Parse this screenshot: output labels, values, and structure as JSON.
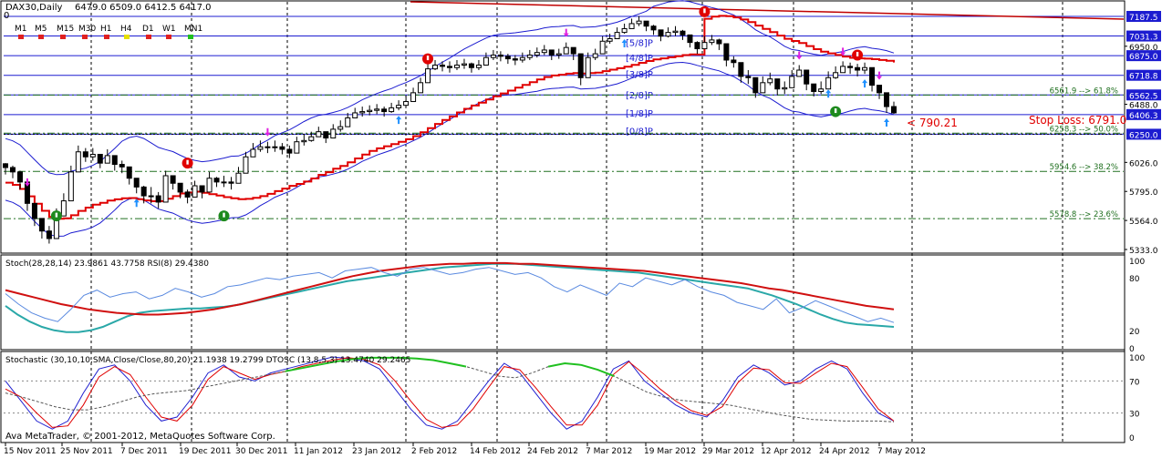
{
  "header": {
    "symbol": "DAX30,Daily",
    "ohlc": "6479.0 6509.0 6412.5 6417.0",
    "indicator_value": "0"
  },
  "timeframes": [
    {
      "label": "M1",
      "color": "#e02020"
    },
    {
      "label": "M5",
      "color": "#e02020"
    },
    {
      "label": "M15",
      "color": "#e02020"
    },
    {
      "label": "M30",
      "color": "#e02020"
    },
    {
      "label": "H1",
      "color": "#e02020"
    },
    {
      "label": "H4",
      "color": "#e6e000"
    },
    {
      "label": "D1",
      "color": "#e02020"
    },
    {
      "label": "W1",
      "color": "#e02020"
    },
    {
      "label": "MN1",
      "color": "#20c020"
    }
  ],
  "colors": {
    "background": "#ffffff",
    "grid": "#000000",
    "murrey": "#1c1cd0",
    "envelope": "#1c1cd0",
    "trail": "#e00000",
    "fib": "#207020",
    "up_arrow": "#1e90ff",
    "down_arrow": "#e020e0",
    "fractal_red": "#e00000",
    "fractal_green": "#1e8a1e",
    "price_box": "#1c1cd0",
    "stoch_main": "#2aa8a8",
    "stoch_signal": "#d01010",
    "rsi": "#5a8ae0",
    "dtosc_blue": "#2020d0",
    "dtosc_red": "#e00000",
    "green": "#20c020",
    "stoploss": "#e00000"
  },
  "price_labels": [
    "7187.5",
    "7031.3",
    "6950.0",
    "6875.0",
    "6718.8",
    "6562.5",
    "6488.0",
    "6406.3",
    "6250.0",
    "6026.0",
    "5795.0",
    "5564.0",
    "5333.0"
  ],
  "price_boxes": [
    "7187.5",
    "7031.3",
    "6875.0",
    "6718.8",
    "6562.5",
    "6406.3",
    "6250.0"
  ],
  "murrey_labels": [
    "[5/8]P",
    "[4/8]P",
    "[3/8]P",
    "[2/8]P",
    "[1/8]P",
    "[0/8]P"
  ],
  "fib_labels": [
    "6561.9 --> 61.8%",
    "6258.3 --> 50.0%",
    "5954.6 --> 38.2%",
    "5578.8 --> 23.6%"
  ],
  "annotations": {
    "stop_loss": "Stop Loss: 6791.0",
    "target": "< 790.21"
  },
  "panel2": {
    "title": "Stoch(28,28,14) 23.9861 43.7758  RSI(8) 29.4380",
    "levels": [
      "100",
      "80",
      "20",
      "0"
    ]
  },
  "panel3": {
    "title": "Stochastic (30,10,10,SMA,Close/Close,80,20) 21.1938 19.2799   DTOSC (13,8,5,3) 13.4740 29.2465",
    "levels": [
      "100",
      "70",
      "30",
      "0"
    ]
  },
  "watermark": "Ava MetaTrader, © 2001-2012, MetaQuotes Software Corp.",
  "x_labels": [
    "15 Nov 2011",
    "25 Nov 2011",
    "7 Dec 2011",
    "19 Dec 2011",
    "30 Dec 2011",
    "11 Jan 2012",
    "23 Jan 2012",
    "2 Feb 2012",
    "14 Feb 2012",
    "24 Feb 2012",
    "7 Mar 2012",
    "19 Mar 2012",
    "29 Mar 2012",
    "12 Apr 2012",
    "24 Apr 2012",
    "7 May 2012"
  ],
  "chart_data": [
    {
      "type": "candlestick",
      "title": "DAX30,Daily",
      "ohlc_last": [
        6479.0,
        6509.0,
        6412.5,
        6417.0
      ],
      "ylim": [
        5333.0,
        7187.5
      ],
      "murrey_levels": [
        7187.5,
        7031.3,
        6875.0,
        6718.8,
        6562.5,
        6406.3,
        6250.0
      ],
      "fib_levels": [
        {
          "value": 6561.9,
          "pct": "61.8%"
        },
        {
          "value": 6258.3,
          "pct": "50.0%"
        },
        {
          "value": 5954.6,
          "pct": "38.2%"
        },
        {
          "value": 5578.8,
          "pct": "23.6%"
        }
      ],
      "closes": [
        5985,
        5950,
        5870,
        5700,
        5580,
        5480,
        5420,
        5600,
        5720,
        5950,
        6110,
        6070,
        6090,
        6020,
        6080,
        6010,
        5990,
        5900,
        5830,
        5760,
        5760,
        5710,
        5920,
        5860,
        5790,
        5750,
        5840,
        5790,
        5900,
        5870,
        5870,
        5860,
        5940,
        6070,
        6130,
        6150,
        6150,
        6150,
        6130,
        6100,
        6190,
        6200,
        6230,
        6270,
        6220,
        6290,
        6310,
        6380,
        6420,
        6430,
        6440,
        6450,
        6430,
        6460,
        6480,
        6510,
        6580,
        6660,
        6770,
        6800,
        6790,
        6780,
        6800,
        6810,
        6780,
        6800,
        6860,
        6880,
        6870,
        6850,
        6840,
        6860,
        6880,
        6900,
        6920,
        6880,
        6890,
        6940,
        6890,
        6700,
        6860,
        6890,
        6990,
        7010,
        7060,
        7090,
        7130,
        7150,
        7110,
        7080,
        7030,
        7060,
        7070,
        7040,
        6980,
        6930,
        6980,
        7000,
        6970,
        6840,
        6820,
        6710,
        6700,
        6580,
        6660,
        6690,
        6610,
        6620,
        6710,
        6760,
        6650,
        6590,
        6610,
        6700,
        6740,
        6790,
        6780,
        6760,
        6780,
        6640,
        6580,
        6470,
        6420
      ],
      "highs": [
        6020,
        6000,
        5960,
        5790,
        5680,
        5560,
        5520,
        5660,
        5780,
        6000,
        6160,
        6140,
        6140,
        6090,
        6130,
        6080,
        6040,
        5980,
        5900,
        5840,
        5830,
        5790,
        5960,
        5910,
        5860,
        5810,
        5880,
        5840,
        5950,
        5910,
        5920,
        5910,
        5990,
        6110,
        6180,
        6200,
        6190,
        6200,
        6180,
        6160,
        6230,
        6250,
        6270,
        6310,
        6270,
        6330,
        6360,
        6420,
        6460,
        6470,
        6480,
        6490,
        6470,
        6500,
        6520,
        6560,
        6620,
        6700,
        6810,
        6840,
        6830,
        6830,
        6840,
        6850,
        6820,
        6840,
        6900,
        6920,
        6910,
        6890,
        6880,
        6900,
        6920,
        6940,
        6960,
        6920,
        6930,
        6980,
        6930,
        6780,
        6900,
        6930,
        7030,
        7050,
        7100,
        7130,
        7170,
        7190,
        7150,
        7120,
        7080,
        7100,
        7110,
        7080,
        7030,
        6990,
        7030,
        7040,
        7010,
        6900,
        6870,
        6770,
        6760,
        6640,
        6710,
        6740,
        6660,
        6670,
        6760,
        6800,
        6720,
        6650,
        6670,
        6750,
        6790,
        6830,
        6820,
        6810,
        6820,
        6700,
        6640,
        6520,
        6509
      ],
      "lows": [
        5930,
        5900,
        5810,
        5640,
        5520,
        5420,
        5380,
        5550,
        5680,
        5890,
        6030,
        6030,
        6040,
        5980,
        6030,
        5960,
        5940,
        5850,
        5780,
        5700,
        5700,
        5660,
        5860,
        5810,
        5740,
        5700,
        5790,
        5740,
        5850,
        5830,
        5830,
        5810,
        5890,
        6020,
        6090,
        6110,
        6100,
        6110,
        6090,
        6060,
        6150,
        6160,
        6190,
        6230,
        6180,
        6250,
        6270,
        6340,
        6380,
        6390,
        6400,
        6410,
        6390,
        6420,
        6440,
        6470,
        6540,
        6620,
        6720,
        6760,
        6750,
        6740,
        6760,
        6770,
        6740,
        6760,
        6820,
        6840,
        6830,
        6810,
        6800,
        6820,
        6840,
        6860,
        6880,
        6840,
        6850,
        6900,
        6840,
        6640,
        6810,
        6840,
        6940,
        6970,
        7020,
        7050,
        7090,
        7110,
        7070,
        7040,
        6990,
        7020,
        7030,
        7000,
        6940,
        6890,
        6940,
        6960,
        6920,
        6790,
        6780,
        6660,
        6650,
        6540,
        6610,
        6640,
        6560,
        6570,
        6660,
        6710,
        6600,
        6550,
        6570,
        6650,
        6690,
        6740,
        6730,
        6710,
        6730,
        6590,
        6530,
        6420,
        6412.5
      ]
    },
    {
      "type": "line",
      "title": "Stoch(28,28,14) 23.9861 43.7758  RSI(8) 29.4380",
      "ylim": [
        0,
        100
      ],
      "levels": [
        80,
        20
      ],
      "series": [
        {
          "name": "Stoch(28,28,14)",
          "values": [
            48,
            38,
            30,
            24,
            20,
            18,
            18,
            20,
            24,
            30,
            36,
            40,
            42,
            43,
            44,
            45,
            45,
            46,
            47,
            49,
            52,
            55,
            58,
            61,
            64,
            67,
            70,
            73,
            76,
            78,
            80,
            82,
            84,
            86,
            88,
            90,
            92,
            93,
            94,
            95,
            96,
            96,
            96,
            95,
            94,
            93,
            92,
            91,
            90,
            89,
            88,
            87,
            86,
            84,
            82,
            80,
            78,
            76,
            74,
            72,
            70,
            68,
            64,
            60,
            55,
            50,
            44,
            38,
            33,
            29,
            27,
            26,
            25,
            24
          ]
        },
        {
          "name": "",
          "values": [
            66,
            62,
            58,
            54,
            50,
            47,
            44,
            42,
            40,
            39,
            38,
            38,
            39,
            40,
            42,
            44,
            47,
            50,
            54,
            58,
            62,
            66,
            70,
            74,
            78,
            82,
            85,
            88,
            90,
            92,
            94,
            95,
            96,
            96,
            97,
            97,
            97,
            96,
            96,
            95,
            94,
            93,
            92,
            91,
            90,
            89,
            88,
            86,
            84,
            82,
            80,
            78,
            76,
            74,
            71,
            68,
            66,
            63,
            60,
            57,
            54,
            51,
            48,
            46,
            44
          ]
        },
        {
          "name": "RSI(8)",
          "values": [
            62,
            50,
            40,
            34,
            30,
            44,
            60,
            66,
            58,
            62,
            64,
            56,
            60,
            68,
            64,
            58,
            62,
            70,
            72,
            76,
            80,
            78,
            82,
            84,
            86,
            80,
            88,
            90,
            92,
            86,
            82,
            90,
            92,
            88,
            84,
            86,
            90,
            92,
            88,
            84,
            86,
            80,
            70,
            64,
            72,
            66,
            60,
            74,
            70,
            80,
            76,
            72,
            78,
            70,
            64,
            60,
            52,
            48,
            44,
            56,
            40,
            46,
            54,
            48,
            42,
            36,
            30,
            34,
            29
          ]
        }
      ]
    },
    {
      "type": "line",
      "title": "Stochastic (30,10,10,SMA,Close/Close,80,20) 21.1938 19.2799   DTOSC (13,8,5,3) 13.4740 29.2465",
      "ylim": [
        0,
        100
      ],
      "levels": [
        70,
        30
      ],
      "series": [
        {
          "name": "DTOSC (13,8,5,3)",
          "values": [
            70,
            45,
            20,
            10,
            20,
            55,
            85,
            90,
            70,
            40,
            20,
            25,
            50,
            80,
            90,
            75,
            70,
            80,
            85,
            90,
            95,
            100,
            98,
            95,
            85,
            60,
            35,
            15,
            10,
            20,
            45,
            70,
            92,
            80,
            55,
            30,
            10,
            20,
            50,
            85,
            95,
            70,
            55,
            40,
            30,
            25,
            45,
            75,
            90,
            80,
            65,
            70,
            85,
            95,
            85,
            55,
            30,
            20
          ]
        },
        {
          "name": "",
          "values": [
            60,
            50,
            30,
            12,
            14,
            40,
            75,
            88,
            78,
            50,
            25,
            20,
            40,
            72,
            88,
            80,
            72,
            78,
            82,
            88,
            92,
            96,
            99,
            97,
            90,
            70,
            45,
            22,
            12,
            15,
            35,
            62,
            88,
            84,
            62,
            38,
            15,
            15,
            40,
            78,
            94,
            78,
            60,
            45,
            33,
            27,
            38,
            68,
            86,
            84,
            68,
            67,
            80,
            92,
            88,
            62,
            35,
            20
          ]
        },
        {
          "name": "Stochastic (30,10,10,SMA,Close/Close,80,20)",
          "values": [
            55,
            50,
            44,
            38,
            34,
            34,
            38,
            44,
            50,
            54,
            56,
            58,
            62,
            66,
            70,
            74,
            78,
            82,
            86,
            90,
            94,
            97,
            99,
            99,
            99,
            98,
            96,
            92,
            88,
            82,
            76,
            74,
            80,
            88,
            92,
            90,
            84,
            76,
            66,
            56,
            50,
            46,
            44,
            42,
            40,
            36,
            32,
            28,
            25,
            22,
            21,
            20,
            20,
            20,
            19
          ]
        }
      ]
    }
  ]
}
